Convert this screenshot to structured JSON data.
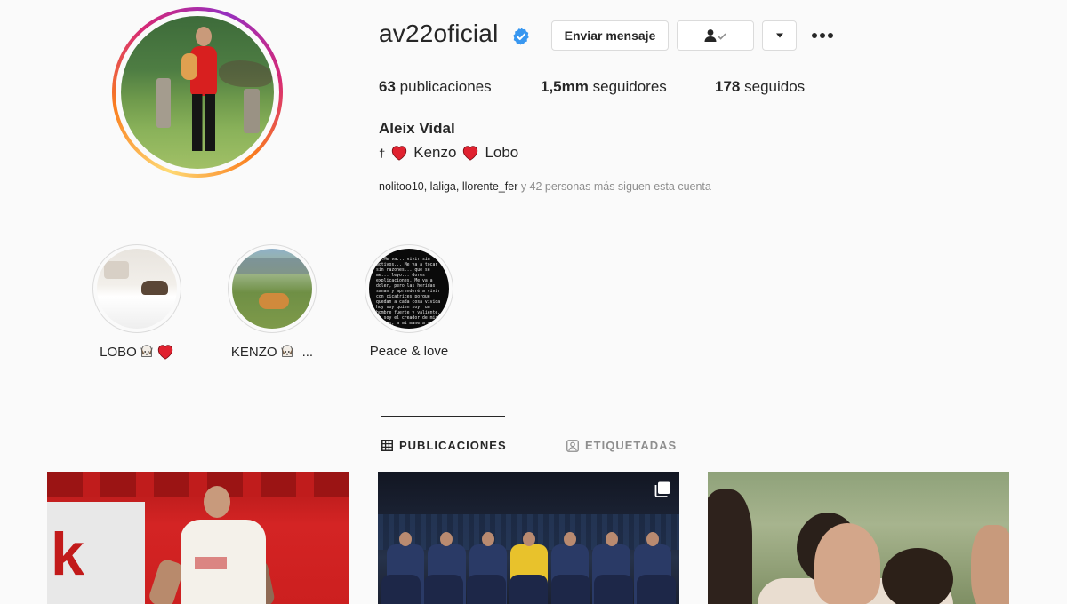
{
  "profile": {
    "username": "av22oficial",
    "verified": true,
    "full_name": "Aleix Vidal",
    "bio_prefix": "†",
    "bio_items": [
      "Kenzo",
      "Lobo"
    ],
    "followed_by_names": "nolitoo10, laliga, llorente_fer",
    "followed_by_suffix": " y 42 personas más siguen esta cuenta"
  },
  "actions": {
    "message_label": "Enviar mensaje"
  },
  "stats": {
    "posts_count": "63",
    "posts_label": "publicaciones",
    "followers_count": "1,5mm",
    "followers_label": "seguidores",
    "following_count": "178",
    "following_label": "seguidos"
  },
  "highlights": [
    {
      "label": "LOBO"
    },
    {
      "label": "KENZO",
      "suffix": "..."
    },
    {
      "label": "Peace & love"
    }
  ],
  "peace_story_text": "...Me va... vivir sin motivos... Me va a tocar sin razones... que se me... leyo... dores explicaciones. Me va a doler, pero las heridas sanan y aprenderé a vivir con cicatrices porque quedan a cada cosa vivida hoy soy quien soy, un hombre fuerte y valiente. Yo soy el creador de mis sueños, a mi manera y lo que...",
  "tabs": {
    "posts_label": "PUBLICACIONES",
    "tagged_label": "ETIQUETADAS"
  },
  "colors": {
    "verified_blue": "#3897f0",
    "heart_red": "#e0212f",
    "text_primary": "#262626",
    "text_secondary": "#8e8e8e"
  },
  "icons": {
    "verified": "verified-badge-icon",
    "following": "person-check-icon",
    "dropdown": "caret-down-icon",
    "more": "more-dots-icon",
    "grid": "grid-icon",
    "tagged": "tagged-person-icon",
    "multi": "multiple-photos-icon"
  }
}
